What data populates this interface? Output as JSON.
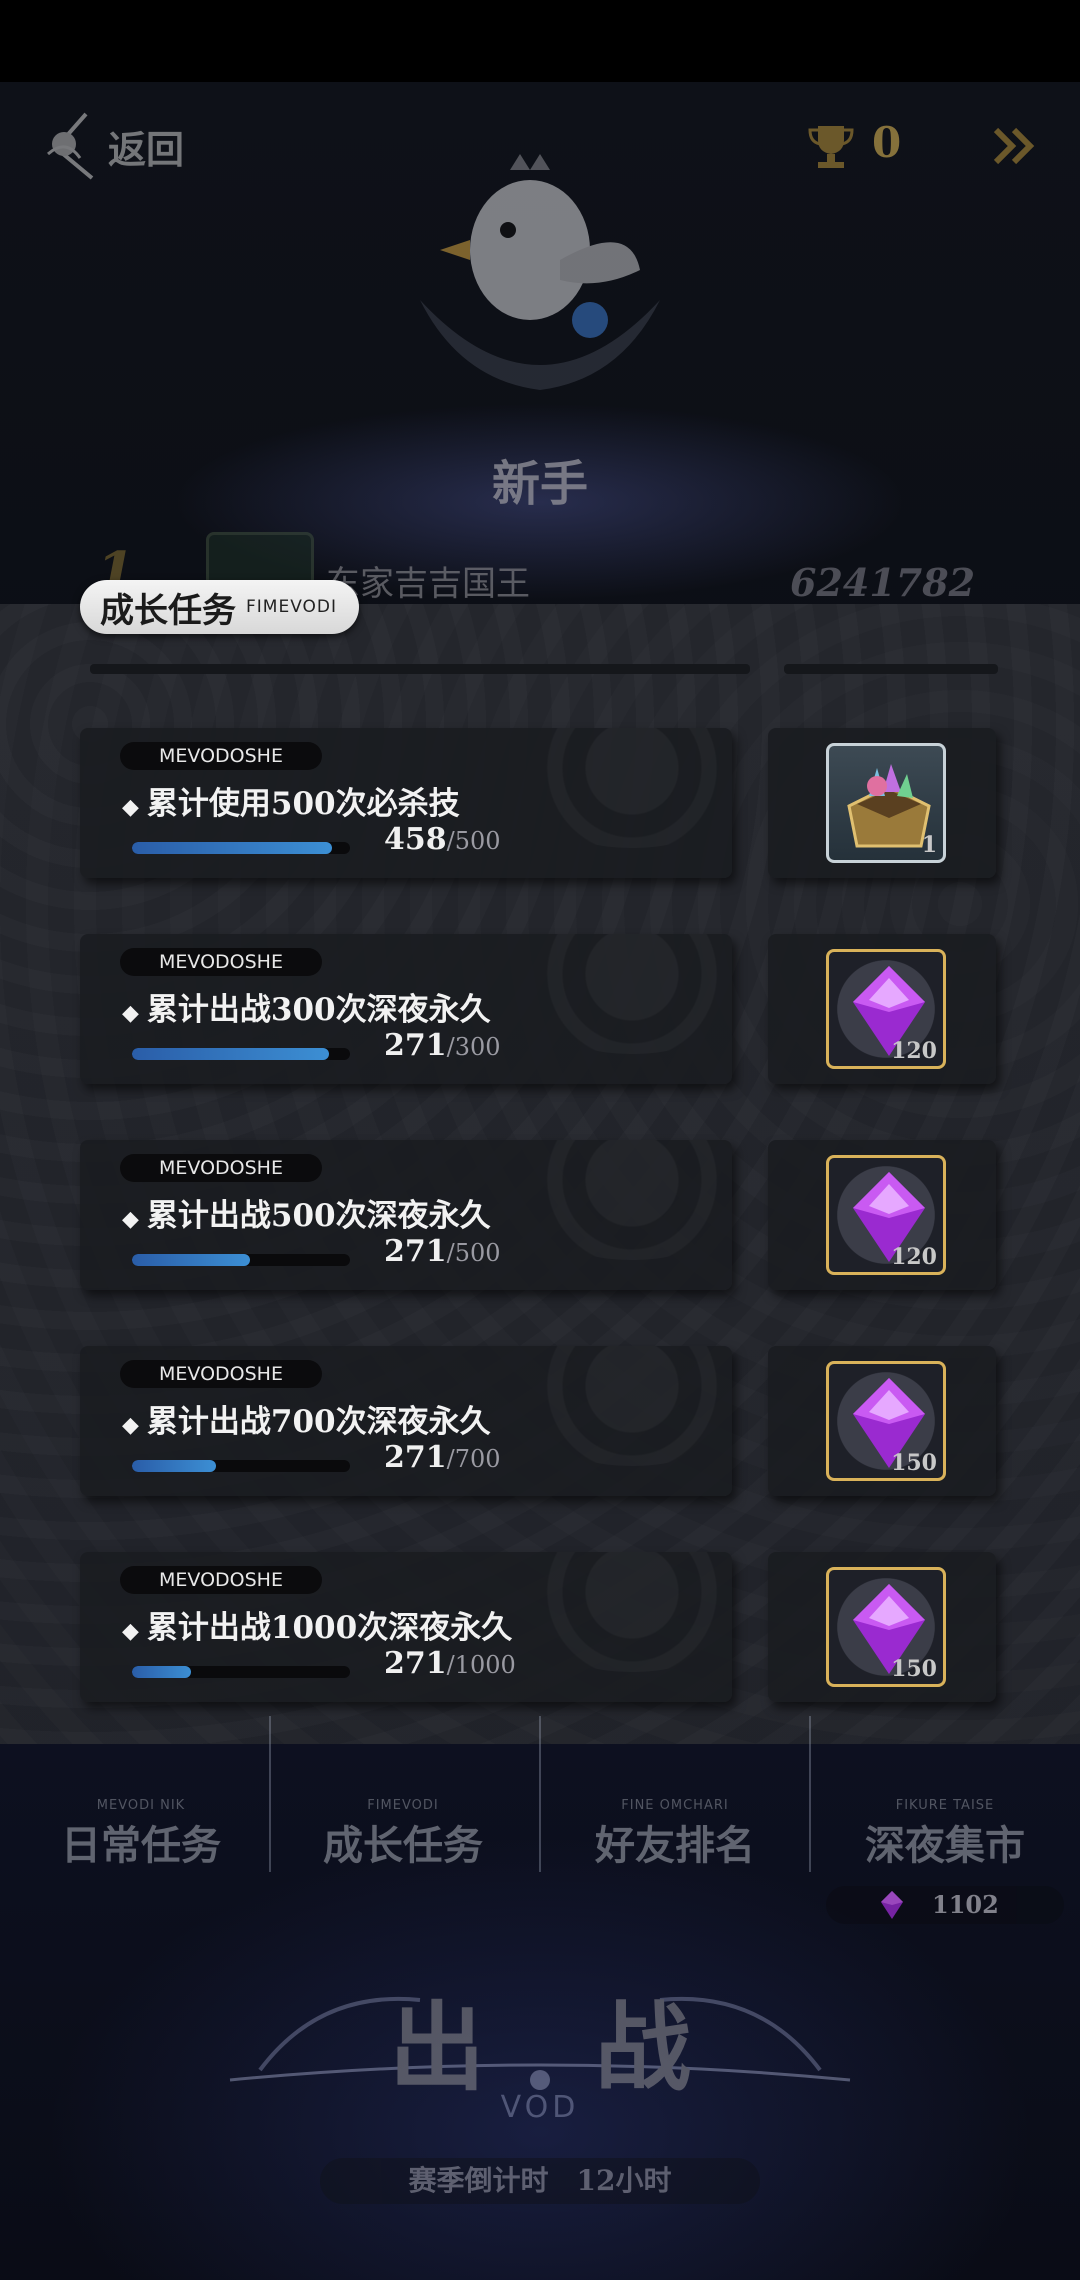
{
  "header": {
    "back_label": "返回",
    "trophy_count": "0"
  },
  "rank": {
    "title": "新手"
  },
  "leaderboard_peek": {
    "rank": "1",
    "name": "东家吉吉国王",
    "score": "6241782"
  },
  "panel": {
    "title": "成长任务",
    "subtitle": "FIMEVODI",
    "tasks": [
      {
        "tag": "MEVODOSHE",
        "title": "累计使用500次必杀技",
        "current": "458",
        "total": "/500",
        "progress": 0.916,
        "reward_icon": "chest-icon",
        "reward_qty": "1"
      },
      {
        "tag": "MEVODOSHE",
        "title": "累计出战300次深夜永久",
        "current": "271",
        "total": "/300",
        "progress": 0.903,
        "reward_icon": "purple-gem-icon",
        "reward_qty": "120"
      },
      {
        "tag": "MEVODOSHE",
        "title": "累计出战500次深夜永久",
        "current": "271",
        "total": "/500",
        "progress": 0.542,
        "reward_icon": "purple-gem-icon",
        "reward_qty": "120"
      },
      {
        "tag": "MEVODOSHE",
        "title": "累计出战700次深夜永久",
        "current": "271",
        "total": "/700",
        "progress": 0.387,
        "reward_icon": "purple-gem-icon",
        "reward_qty": "150"
      },
      {
        "tag": "MEVODOSHE",
        "title": "累计出战1000次深夜永久",
        "current": "271",
        "total": "/1000",
        "progress": 0.271,
        "reward_icon": "purple-gem-icon",
        "reward_qty": "150"
      }
    ]
  },
  "tabs": [
    {
      "sub": "MEVODI NIK",
      "label": "日常任务"
    },
    {
      "sub": "FIMEVODI",
      "label": "成长任务"
    },
    {
      "sub": "FINE OMCHARI",
      "label": "好友排名"
    },
    {
      "sub": "FIKURE TAISE",
      "label": "深夜集市"
    }
  ],
  "currency": {
    "value": "1102",
    "icon": "purple-gem-icon"
  },
  "battle": {
    "label": "出战",
    "sub": "VOD",
    "countdown_label": "赛季倒计时",
    "countdown_value": "12小时"
  },
  "colors": {
    "progress_bar": "#3c8fd4",
    "reward_gold_frame": "#d9b25a",
    "gem_purple": "#b03be0",
    "panel_bg": "#26282e"
  }
}
